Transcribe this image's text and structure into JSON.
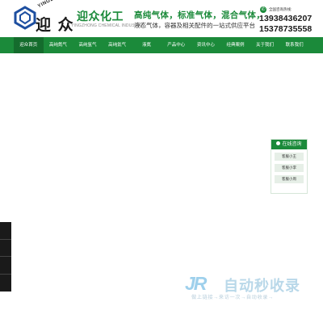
{
  "header": {
    "logo": {
      "en": "YINGZHONG",
      "cn": "迎 众",
      "mark": "hexagon-logo-icon"
    },
    "brand": {
      "cn": "迎众化工",
      "en": "YINGZHONG CHEMICAL INDUSTRY"
    },
    "slogan": {
      "line1": "高纯气体，标准气体，混合气体，",
      "line2": "液态气体，容器及相关配件的一站式供应平台"
    },
    "hotline": {
      "label": "全国咨询热线:",
      "phone1": "13938436207",
      "phone2": "15378735558",
      "icon": "phone-icon"
    }
  },
  "nav": {
    "items": [
      {
        "label": "迎众首页"
      },
      {
        "label": "高纯氮气"
      },
      {
        "label": "高纯氩气"
      },
      {
        "label": "高纯氦气"
      },
      {
        "label": "液氮"
      },
      {
        "label": "产品中心"
      },
      {
        "label": "资讯中心"
      },
      {
        "label": "经典案例"
      },
      {
        "label": "关于我们"
      },
      {
        "label": "联系我们"
      }
    ]
  },
  "service": {
    "title": "在线咨询",
    "items": [
      {
        "label": "客服小王"
      },
      {
        "label": "客服小李"
      },
      {
        "label": "客服小周"
      }
    ]
  },
  "watermark": {
    "logo": "JR",
    "title": "自动秒收录",
    "subtitle": "做上链接→来访一次→自动收录→"
  },
  "colors": {
    "brand_green": "#1b8a3a",
    "nav_bg": "#1b8a3a",
    "side_tab": "#1a1a1a"
  }
}
